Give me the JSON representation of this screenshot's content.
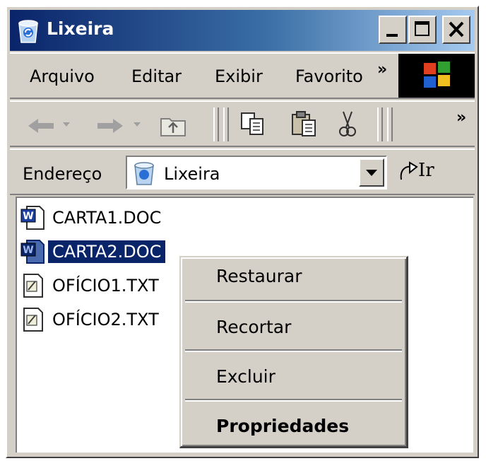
{
  "window": {
    "title": "Lixeira",
    "title_icon": "recycle-bin-icon"
  },
  "title_buttons": {
    "minimize": "minimize-icon",
    "maximize": "maximize-icon",
    "close": "close-icon"
  },
  "menu": {
    "items": [
      "Arquivo",
      "Editar",
      "Exibir",
      "Favorito"
    ],
    "overflow": "»"
  },
  "toolbar": {
    "icons": [
      "back-arrow-icon",
      "forward-arrow-icon",
      "up-folder-icon",
      "copy-icon",
      "paste-icon",
      "cut-icon"
    ],
    "overflow": "»"
  },
  "address": {
    "label": "Endereço",
    "value": "Lixeira",
    "go_label": "Ir"
  },
  "files": [
    {
      "name": "CARTA1.DOC",
      "type": "word-doc-icon",
      "selected": false
    },
    {
      "name": "CARTA2.DOC",
      "type": "word-doc-icon",
      "selected": true
    },
    {
      "name": "OFÍCIO1.TXT",
      "type": "text-file-icon",
      "selected": false
    },
    {
      "name": "OFÍCIO2.TXT",
      "type": "text-file-icon",
      "selected": false
    }
  ],
  "context_menu": {
    "items": [
      "Restaurar",
      "Recortar",
      "Excluir",
      "Propriedades"
    ],
    "default_item": "Propriedades"
  },
  "colors": {
    "title_start": "#0a246a",
    "title_end": "#a6caf0",
    "selection": "#0a246a",
    "face": "#d4d0c8"
  }
}
